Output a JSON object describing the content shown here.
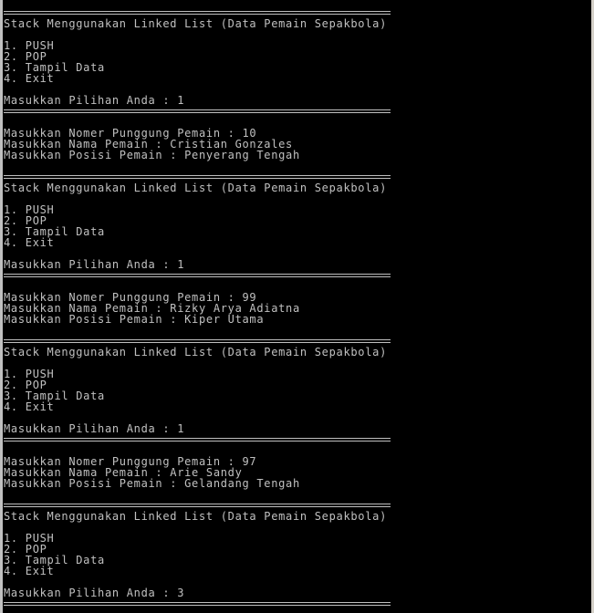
{
  "console": {
    "background": "#000000",
    "text_color": "#c0c0c0",
    "lines": [
      {
        "type": "sep",
        "text": "======================================================"
      },
      {
        "type": "text",
        "text": "Stack Menggunakan Linked List (Data Pemain Sepakbola)"
      },
      {
        "type": "text",
        "text": ""
      },
      {
        "type": "text",
        "text": "1. PUSH"
      },
      {
        "type": "text",
        "text": "2. POP"
      },
      {
        "type": "text",
        "text": "3. Tampil Data"
      },
      {
        "type": "text",
        "text": "4. Exit"
      },
      {
        "type": "text",
        "text": ""
      },
      {
        "type": "text",
        "text": "Masukkan Pilihan Anda : 1"
      },
      {
        "type": "sep",
        "text": "======================================================"
      },
      {
        "type": "text",
        "text": ""
      },
      {
        "type": "text",
        "text": "Masukkan Nomer Punggung Pemain : 10"
      },
      {
        "type": "text",
        "text": "Masukkan Nama Pemain : Cristian Gonzales"
      },
      {
        "type": "text",
        "text": "Masukkan Posisi Pemain : Penyerang Tengah"
      },
      {
        "type": "text",
        "text": ""
      },
      {
        "type": "sep",
        "text": "======================================================"
      },
      {
        "type": "text",
        "text": "Stack Menggunakan Linked List (Data Pemain Sepakbola)"
      },
      {
        "type": "text",
        "text": ""
      },
      {
        "type": "text",
        "text": "1. PUSH"
      },
      {
        "type": "text",
        "text": "2. POP"
      },
      {
        "type": "text",
        "text": "3. Tampil Data"
      },
      {
        "type": "text",
        "text": "4. Exit"
      },
      {
        "type": "text",
        "text": ""
      },
      {
        "type": "text",
        "text": "Masukkan Pilihan Anda : 1"
      },
      {
        "type": "sep",
        "text": "======================================================"
      },
      {
        "type": "text",
        "text": ""
      },
      {
        "type": "text",
        "text": "Masukkan Nomer Punggung Pemain : 99"
      },
      {
        "type": "text",
        "text": "Masukkan Nama Pemain : Rizky Arya Adiatna"
      },
      {
        "type": "text",
        "text": "Masukkan Posisi Pemain : Kiper Utama"
      },
      {
        "type": "text",
        "text": ""
      },
      {
        "type": "sep",
        "text": "======================================================"
      },
      {
        "type": "text",
        "text": "Stack Menggunakan Linked List (Data Pemain Sepakbola)"
      },
      {
        "type": "text",
        "text": ""
      },
      {
        "type": "text",
        "text": "1. PUSH"
      },
      {
        "type": "text",
        "text": "2. POP"
      },
      {
        "type": "text",
        "text": "3. Tampil Data"
      },
      {
        "type": "text",
        "text": "4. Exit"
      },
      {
        "type": "text",
        "text": ""
      },
      {
        "type": "text",
        "text": "Masukkan Pilihan Anda : 1"
      },
      {
        "type": "sep",
        "text": "======================================================"
      },
      {
        "type": "text",
        "text": ""
      },
      {
        "type": "text",
        "text": "Masukkan Nomer Punggung Pemain : 97"
      },
      {
        "type": "text",
        "text": "Masukkan Nama Pemain : Arie Sandy"
      },
      {
        "type": "text",
        "text": "Masukkan Posisi Pemain : Gelandang Tengah"
      },
      {
        "type": "text",
        "text": ""
      },
      {
        "type": "sep",
        "text": "======================================================"
      },
      {
        "type": "text",
        "text": "Stack Menggunakan Linked List (Data Pemain Sepakbola)"
      },
      {
        "type": "text",
        "text": ""
      },
      {
        "type": "text",
        "text": "1. PUSH"
      },
      {
        "type": "text",
        "text": "2. POP"
      },
      {
        "type": "text",
        "text": "3. Tampil Data"
      },
      {
        "type": "text",
        "text": "4. Exit"
      },
      {
        "type": "text",
        "text": ""
      },
      {
        "type": "text",
        "text": "Masukkan Pilihan Anda : 3"
      },
      {
        "type": "sep",
        "text": "======================================================"
      }
    ]
  }
}
